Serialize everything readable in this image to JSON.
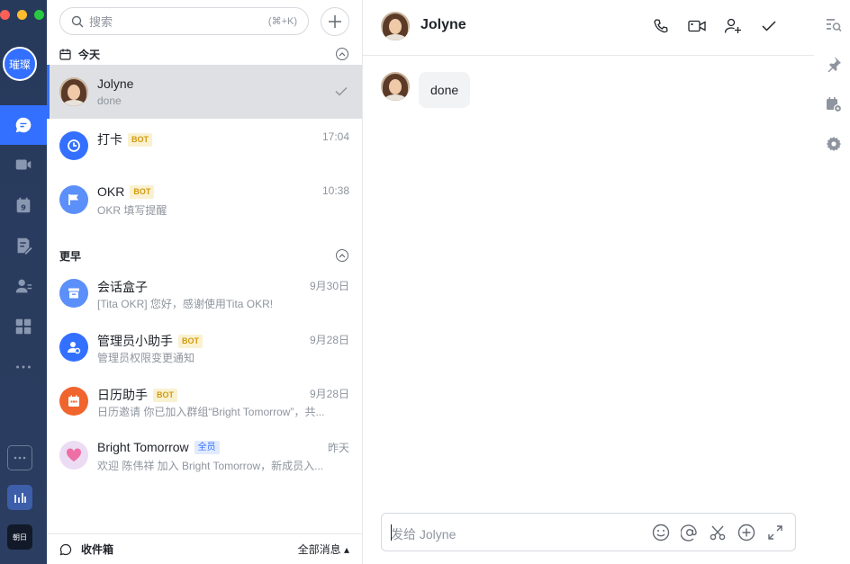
{
  "rail": {
    "user_avatar_text": "璀璨",
    "nav": [
      "messages",
      "video",
      "calendar",
      "docs",
      "contacts",
      "apps",
      "more"
    ],
    "dayday_label": "朝日"
  },
  "list": {
    "search_placeholder": "搜索",
    "search_shortcut": "(⌘+K)",
    "sections": {
      "today": "今天",
      "earlier": "更早"
    },
    "today_items": [
      {
        "name": "Jolyne",
        "sub": "done",
        "time": "",
        "badge": ""
      },
      {
        "name": "打卡",
        "sub": "",
        "time": "17:04",
        "badge": "BOT"
      },
      {
        "name": "OKR",
        "sub": "OKR 填写提醒",
        "time": "10:38",
        "badge": "BOT"
      }
    ],
    "earlier_items": [
      {
        "name": "会话盒子",
        "sub": "[Tita OKR] 您好，感谢使用Tita OKR!",
        "time": "9月30日",
        "badge": ""
      },
      {
        "name": "管理员小助手",
        "sub": "管理员权限变更通知",
        "time": "9月28日",
        "badge": "BOT"
      },
      {
        "name": "日历助手",
        "sub": "日历邀请 你已加入群组“Bright Tomorrow”，共...",
        "time": "9月28日",
        "badge": "BOT"
      },
      {
        "name": "Bright Tomorrow",
        "sub": "欢迎 陈伟祥 加入 Bright Tomorrow，新成员入...",
        "time": "昨天",
        "badge": "全员"
      }
    ],
    "footer": {
      "inbox": "收件箱",
      "filter": "全部消息 ▴"
    }
  },
  "chat": {
    "title": "Jolyne",
    "messages": [
      {
        "text": "done"
      }
    ],
    "composer_placeholder": "发给 Jolyne"
  },
  "colors": {
    "accent": "#3370ff",
    "rail_bg": "#283a5c",
    "bot_badge": "#d39a0e",
    "selected_row": "#dee0e3"
  }
}
